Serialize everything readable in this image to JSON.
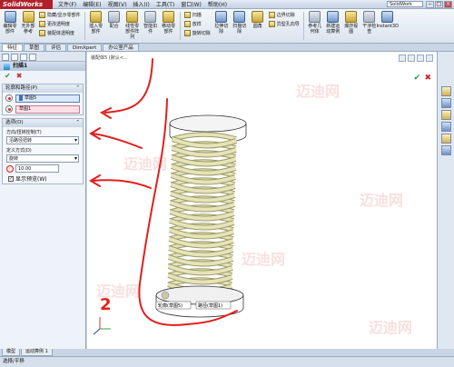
{
  "app": {
    "name": "SolidWorks",
    "menu": [
      "文件(F)",
      "编辑(E)",
      "视图(V)",
      "插入(I)",
      "工具(T)",
      "窗口(W)",
      "帮助(H)"
    ],
    "search": "SolidWork"
  },
  "ribbon": {
    "big_buttons": [
      "编辑零部件",
      "无外部参考",
      "插入零部件",
      "配合",
      "线性零部件阵列",
      "智能扣件",
      "移动零部件",
      "显示隐藏的零部件",
      "装配体特征",
      "参考几何体",
      "新建运动算例",
      "材料明细表",
      "爆炸视图",
      "爆炸直线草图",
      "干涉检查",
      "间隙验证",
      "孔对齐",
      "装配体透明度",
      "Instant3D"
    ],
    "small_rows": [
      "隐藏/显示零部件",
      "更改透明度",
      "装配体透明度",
      "扫描",
      "放样",
      "旋转切除",
      "拉伸切除",
      "扫描切除",
      "圆角",
      "边界切除",
      "异型孔向导"
    ]
  },
  "tabs": [
    "特征",
    "草图",
    "评估",
    "DimXpert",
    "办公室产品"
  ],
  "panel": {
    "title": "扫描1",
    "section_profile": "轮廓和路径(P)",
    "profile_value": "草图5",
    "path_value": "草图1",
    "section_options": "选项(O)",
    "orient_label": "方向/扭转控制(T)",
    "orient_value": "沿路径扭转",
    "define_label": "定义方式(D)",
    "define_value": "旋转",
    "turns_value": "10.00",
    "show_preview": "显示预览(W)"
  },
  "canvas": {
    "breadcrumb": "装配体5 (默认<...",
    "label_profile": "轮廓(草图5)",
    "label_path": "路径(草图1)",
    "watermarks": [
      "迈迪网",
      "迈迪网",
      "迈迪网",
      "迈迪网",
      "迈迪网",
      "迈迪网"
    ],
    "annotation_number": "2"
  },
  "bottom_tabs": [
    "模型",
    "运动算例 1"
  ],
  "status": "选择/平移",
  "colors": {
    "spring": "#e6e3b8",
    "spring_stroke": "#9a9968",
    "annotation": "#e0201c"
  }
}
